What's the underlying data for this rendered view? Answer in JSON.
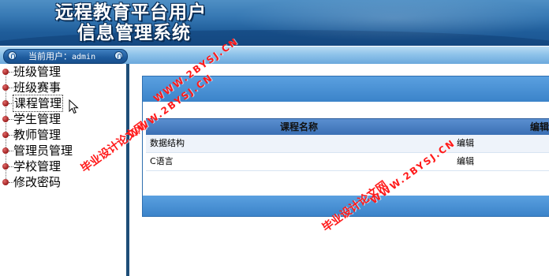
{
  "header": {
    "title_line1": "远程教育平台用户",
    "title_line2": "信息管理系统"
  },
  "subbar": {
    "user_label": "当前用户：",
    "user_name": "admin"
  },
  "sidebar": {
    "items": [
      {
        "label": "班级管理"
      },
      {
        "label": "班级赛事"
      },
      {
        "label": "课程管理"
      },
      {
        "label": "学生管理"
      },
      {
        "label": "教师管理"
      },
      {
        "label": "管理员管理"
      },
      {
        "label": "学校管理"
      },
      {
        "label": "修改密码"
      }
    ],
    "active_index": 2
  },
  "table": {
    "columns": [
      "课程名称",
      "编辑"
    ],
    "rows": [
      {
        "name": "数据结构",
        "action": "编辑"
      },
      {
        "name": "C语言",
        "action": "编辑"
      }
    ]
  },
  "watermarks": {
    "cn1": "毕业设计论文网",
    "url1": "WWW.2BYSJ.CN",
    "cn2": "毕业设计论文网",
    "url2": "WWW.2BYSJ.CN",
    "url3": "WWW.2BYSJ.CN",
    "color": "#ff1a1a"
  },
  "colors": {
    "header_blue": "#1f5d9a",
    "accent_blue": "#3b83c9",
    "sidebar_divider": "#1e4e78"
  }
}
